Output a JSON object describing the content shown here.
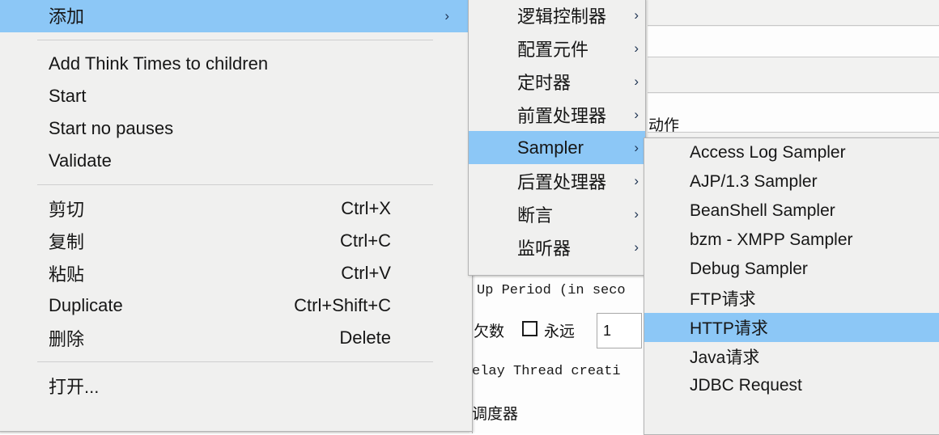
{
  "app_background": {
    "form_labels": {
      "ramp_up": "Up Period (in seco",
      "loop_count": "欠数",
      "forever_checkbox_label": "永远",
      "loop_count_value": "1",
      "delay_thread": "elay Thread creati",
      "scheduler": "调度器",
      "action_partial": "动作"
    }
  },
  "context_menu": {
    "items": [
      {
        "label": "添加",
        "accel": "",
        "arrow": "›",
        "selected": true,
        "type": "submenu"
      },
      {
        "type": "separator"
      },
      {
        "label": "Add Think Times to children",
        "accel": "",
        "selected": false,
        "type": "item"
      },
      {
        "label": "Start",
        "accel": "",
        "selected": false,
        "type": "item"
      },
      {
        "label": "Start no pauses",
        "accel": "",
        "selected": false,
        "type": "item"
      },
      {
        "label": "Validate",
        "accel": "",
        "selected": false,
        "type": "item"
      },
      {
        "type": "separator"
      },
      {
        "label": "剪切",
        "accel": "Ctrl+X",
        "selected": false,
        "type": "item"
      },
      {
        "label": "复制",
        "accel": "Ctrl+C",
        "selected": false,
        "type": "item"
      },
      {
        "label": "粘贴",
        "accel": "Ctrl+V",
        "selected": false,
        "type": "item"
      },
      {
        "label": "Duplicate",
        "accel": "Ctrl+Shift+C",
        "selected": false,
        "type": "item"
      },
      {
        "label": "删除",
        "accel": "Delete",
        "selected": false,
        "type": "item"
      },
      {
        "type": "separator"
      },
      {
        "label": "打开...",
        "accel": "",
        "selected": false,
        "type": "item"
      }
    ]
  },
  "add_submenu": {
    "items": [
      {
        "label": "逻辑控制器",
        "arrow": "›",
        "selected": false
      },
      {
        "label": "配置元件",
        "arrow": "›",
        "selected": false
      },
      {
        "label": "定时器",
        "arrow": "›",
        "selected": false
      },
      {
        "label": "前置处理器",
        "arrow": "›",
        "selected": false
      },
      {
        "label": "Sampler",
        "arrow": "›",
        "selected": true
      },
      {
        "label": "后置处理器",
        "arrow": "›",
        "selected": false
      },
      {
        "label": "断言",
        "arrow": "›",
        "selected": false
      },
      {
        "label": "监听器",
        "arrow": "›",
        "selected": false
      }
    ]
  },
  "sampler_submenu": {
    "items": [
      {
        "label": "Access Log Sampler",
        "selected": false
      },
      {
        "label": "AJP/1.3 Sampler",
        "selected": false
      },
      {
        "label": "BeanShell Sampler",
        "selected": false
      },
      {
        "label": "bzm - XMPP Sampler",
        "selected": false
      },
      {
        "label": "Debug Sampler",
        "selected": false
      },
      {
        "label": "FTP请求",
        "selected": false
      },
      {
        "label": "HTTP请求",
        "selected": true
      },
      {
        "label": "Java请求",
        "selected": false
      },
      {
        "label": "JDBC Request",
        "selected": false
      }
    ]
  },
  "colors": {
    "menu_background": "#f0f0ef",
    "menu_border": "#b4b4b4",
    "selection_highlight": "#8cc7f6",
    "text": "#161616",
    "separator": "#cfcfcf",
    "app_background": "#f2f2f1"
  }
}
